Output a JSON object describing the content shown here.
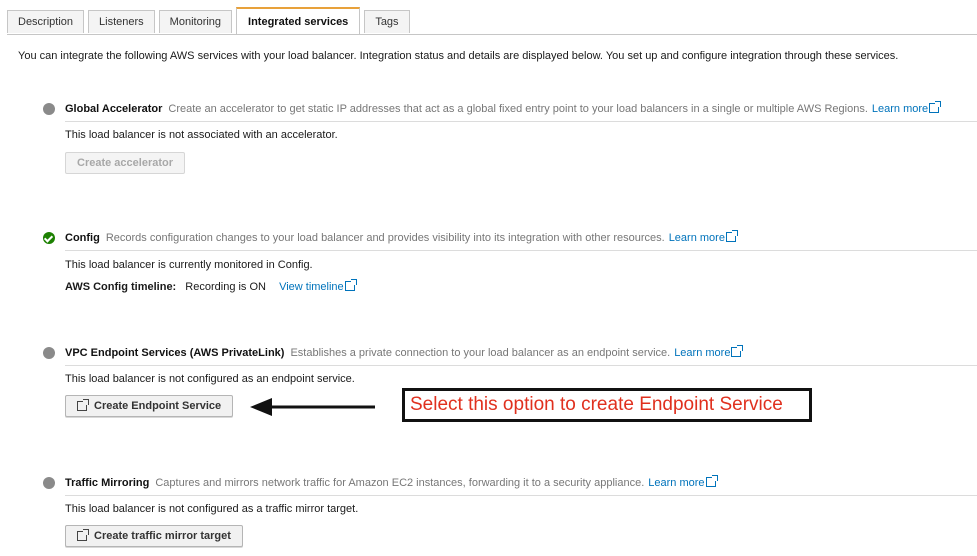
{
  "tabs": [
    {
      "label": "Description"
    },
    {
      "label": "Listeners"
    },
    {
      "label": "Monitoring"
    },
    {
      "label": "Integrated services"
    },
    {
      "label": "Tags"
    }
  ],
  "intro": "You can integrate the following AWS services with your load balancer. Integration status and details are displayed below. You set up and configure integration through these services.",
  "services": {
    "global_accelerator": {
      "name": "Global Accelerator",
      "description": "Create an accelerator to get static IP addresses that act as a global fixed entry point to your load balancers in a single or multiple AWS Regions.",
      "learn_more": "Learn more",
      "status": "This load balancer is not associated with an accelerator.",
      "button": "Create accelerator"
    },
    "config": {
      "name": "Config",
      "description": "Records configuration changes to your load balancer and provides visibility into its integration with other resources.",
      "learn_more": "Learn more",
      "status": "This load balancer is currently monitored in Config.",
      "timeline_label": "AWS Config timeline:",
      "timeline_value": "Recording is ON",
      "timeline_link": "View timeline"
    },
    "vpc_endpoint": {
      "name": "VPC Endpoint Services (AWS PrivateLink)",
      "description": "Establishes a private connection to your load balancer as an endpoint service.",
      "learn_more": "Learn more",
      "status": "This load balancer is not configured as an endpoint service.",
      "button": "Create Endpoint Service"
    },
    "traffic_mirroring": {
      "name": "Traffic Mirroring",
      "description": "Captures and mirrors network traffic for Amazon EC2 instances, forwarding it to a security appliance.",
      "learn_more": "Learn more",
      "status": "This load balancer is not configured as a traffic mirror target.",
      "button": "Create traffic mirror target"
    }
  },
  "annotation": {
    "text": "Select this option to create Endpoint Service",
    "text_color": "#e0301e"
  },
  "colors": {
    "link": "#0073bb",
    "status_ok": "#1d8102",
    "status_neutral": "#8a8a8a",
    "active_tab_accent": "#e8a13a"
  }
}
